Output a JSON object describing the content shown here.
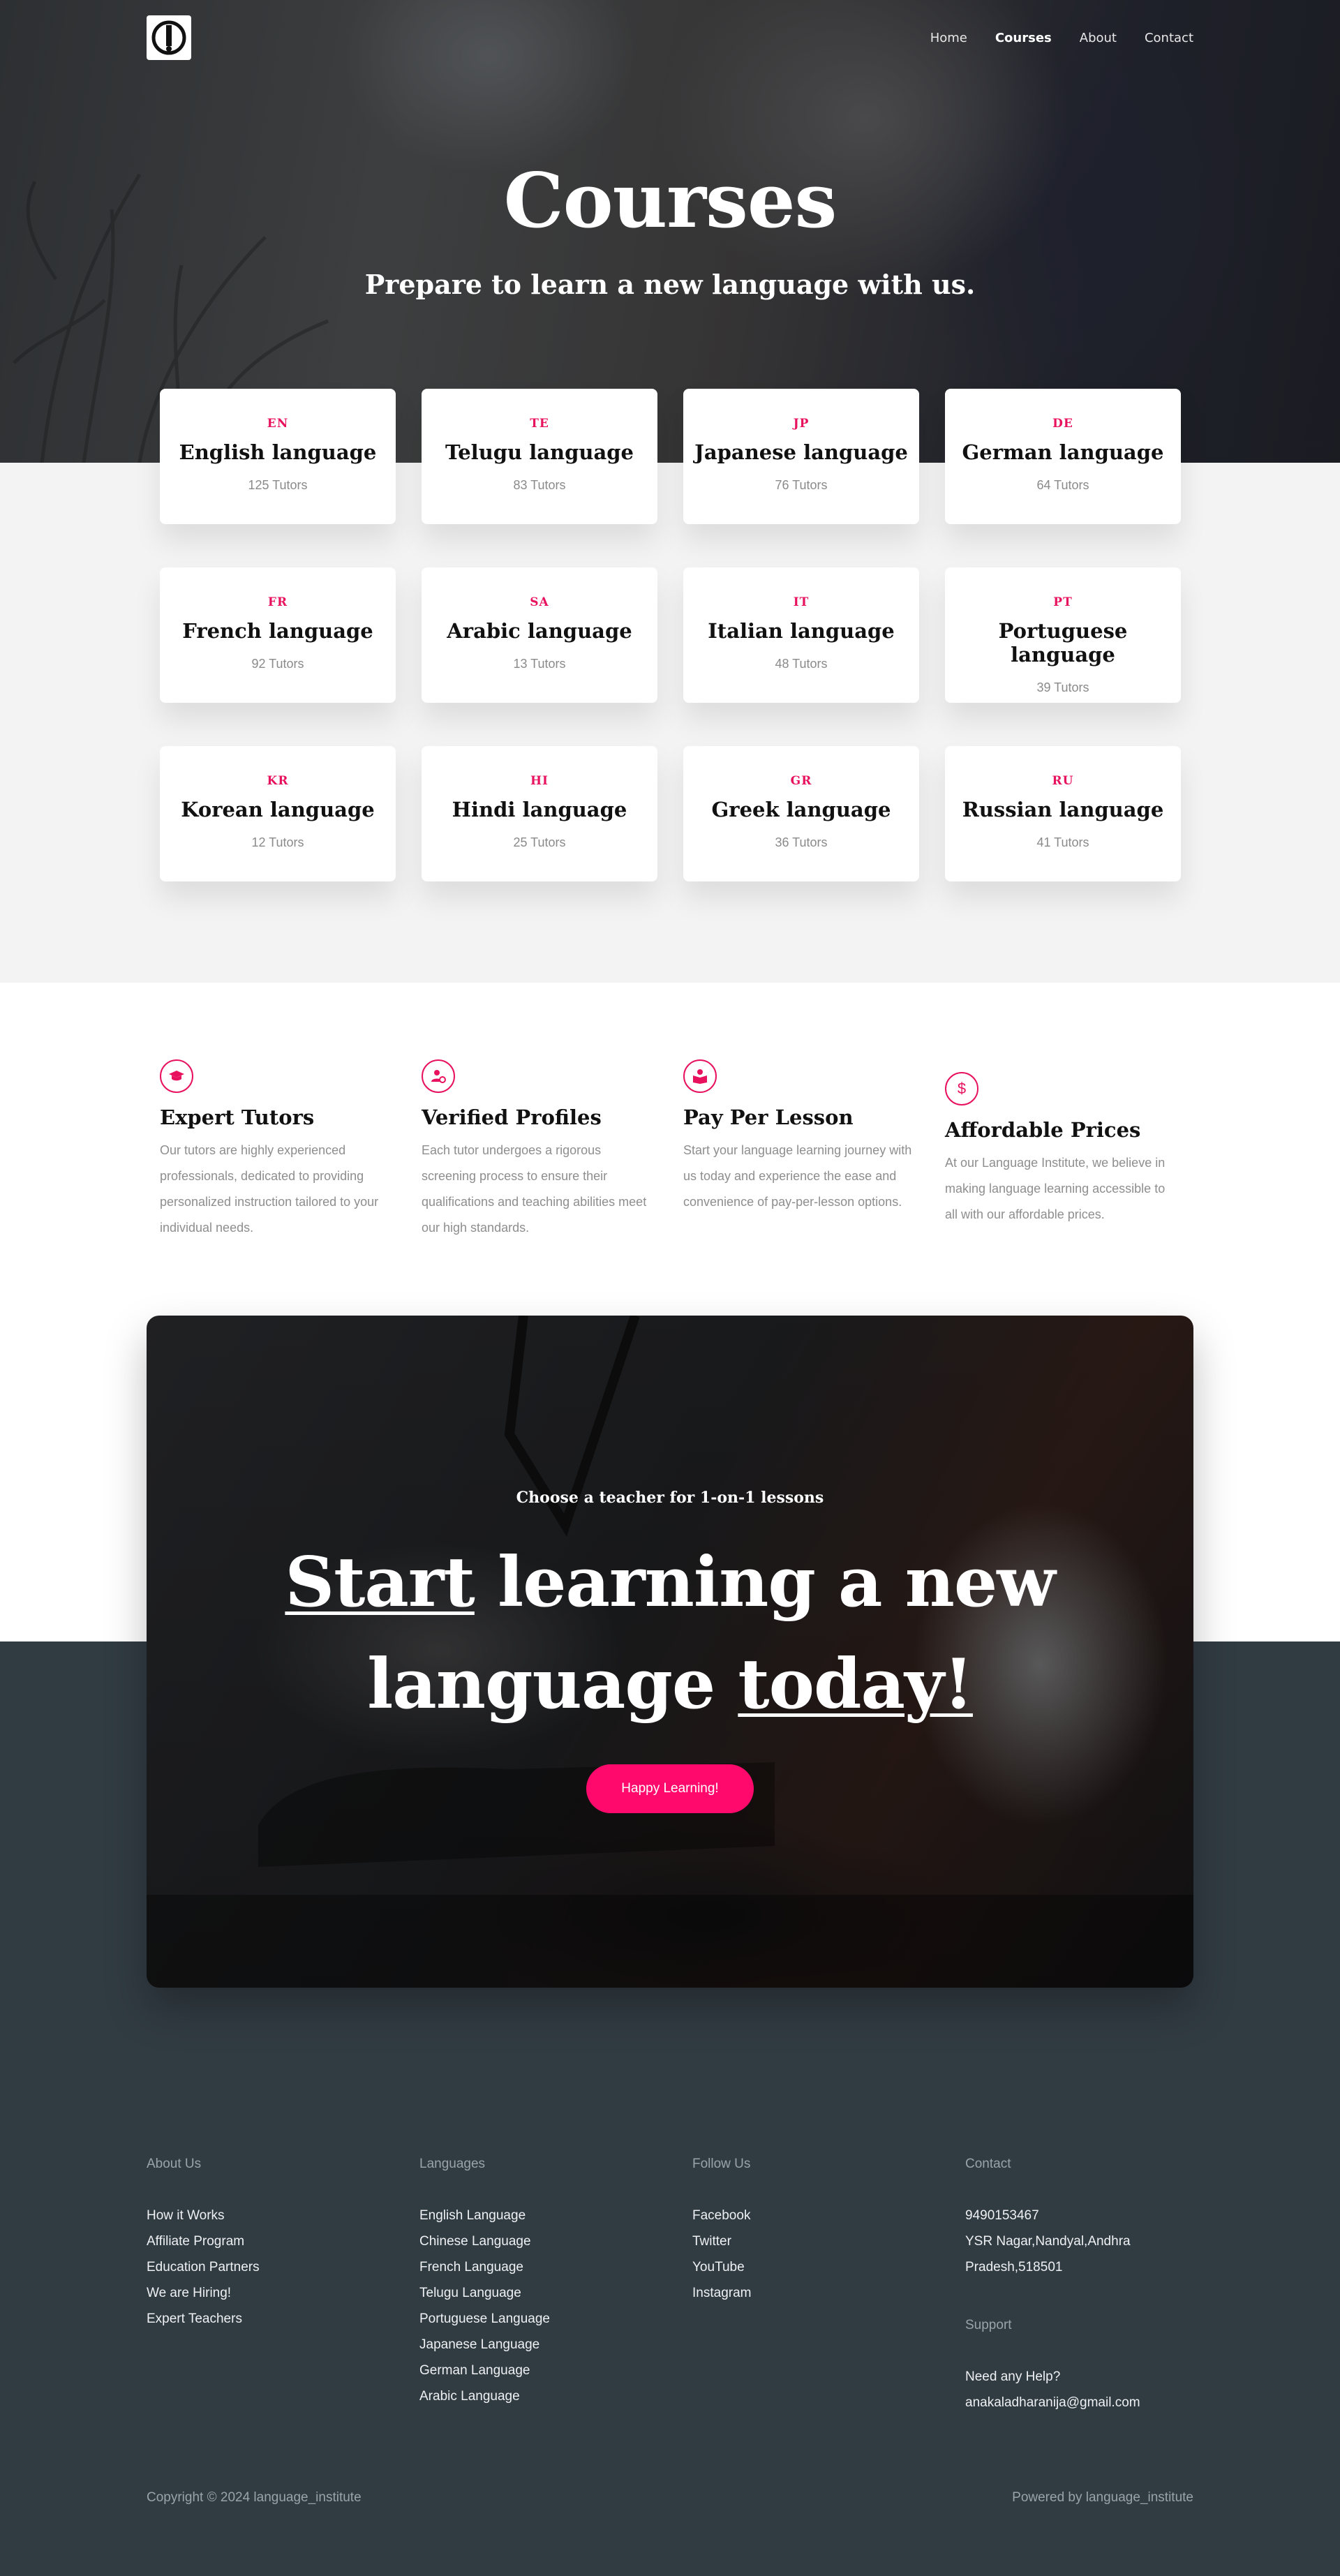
{
  "nav": {
    "logo_alt": "language institute logo",
    "links": [
      {
        "label": "Home"
      },
      {
        "label": "Courses"
      },
      {
        "label": "About"
      },
      {
        "label": "Contact"
      }
    ]
  },
  "hero": {
    "title": "Courses",
    "subtitle": "Prepare to learn a new language with us."
  },
  "courses": [
    {
      "code": "EN",
      "name": "English language",
      "tutors": "125 Tutors"
    },
    {
      "code": "TE",
      "name": "Telugu language",
      "tutors": "83 Tutors"
    },
    {
      "code": "JP",
      "name": "Japanese language",
      "tutors": "76 Tutors"
    },
    {
      "code": "DE",
      "name": "German language",
      "tutors": "64 Tutors"
    },
    {
      "code": "FR",
      "name": "French language",
      "tutors": "92 Tutors"
    },
    {
      "code": "SA",
      "name": "Arabic language",
      "tutors": "13 Tutors"
    },
    {
      "code": "IT",
      "name": "Italian language",
      "tutors": "48 Tutors"
    },
    {
      "code": "PT",
      "name": "Portuguese language",
      "tutors": "39 Tutors"
    },
    {
      "code": "KR",
      "name": "Korean language",
      "tutors": "12 Tutors"
    },
    {
      "code": "HI",
      "name": "Hindi language",
      "tutors": "25 Tutors"
    },
    {
      "code": "GR",
      "name": "Greek language",
      "tutors": "36 Tutors"
    },
    {
      "code": "RU",
      "name": "Russian language",
      "tutors": "41 Tutors"
    }
  ],
  "features": [
    {
      "icon": "graduation-cap-icon",
      "title": "Expert Tutors",
      "desc": "Our tutors are highly experienced professionals, dedicated to providing personalized instruction tailored to your individual needs."
    },
    {
      "icon": "user-check-icon",
      "title": "Verified Profiles",
      "desc": "Each tutor undergoes a rigorous screening process to ensure their qualifications and teaching abilities meet our high standards."
    },
    {
      "icon": "book-reader-icon",
      "title": "Pay Per Lesson",
      "desc": "Start your language learning journey with us today and experience the ease and convenience of pay-per-lesson options."
    },
    {
      "icon": "dollar-icon",
      "title": "Affordable Prices",
      "desc": "At our Language Institute, we believe in making language learning accessible to all with our affordable prices."
    }
  ],
  "cta": {
    "kicker": "Choose a teacher for 1-on-1 lessons",
    "line1_underlined": "Start",
    "line1_rest": " learning a new",
    "line2_plain": "language ",
    "line2_underlined": "today!",
    "button": "Happy Learning!",
    "button_color": "#ff0a6c"
  },
  "footer": {
    "about": {
      "heading": "About Us",
      "links": [
        "How it Works",
        "Affiliate Program",
        "Education Partners",
        "We are Hiring!",
        "Expert Teachers"
      ]
    },
    "languages": {
      "heading": "Languages",
      "links": [
        "English Language",
        "Chinese Language",
        "French Language",
        "Telugu Language",
        "Portuguese Language",
        "Japanese Language",
        "German Language",
        "Arabic Language"
      ]
    },
    "follow": {
      "heading": "Follow Us",
      "links": [
        "Facebook",
        "Twitter",
        "YouTube",
        "Instagram"
      ]
    },
    "contact": {
      "heading": "Contact",
      "phone": "9490153467",
      "address_line1": "YSR Nagar,Nandyal,Andhra",
      "address_line2": "Pradesh,518501",
      "support_heading": "Support",
      "support_text": "Need any Help?",
      "email": "anakaladharanija@gmail.com"
    },
    "copyright": "Copyright © 2024 language_institute",
    "powered": "Powered by language_institute"
  },
  "colors": {
    "accent": "#e8115e",
    "footer_bg": "#313b42"
  }
}
